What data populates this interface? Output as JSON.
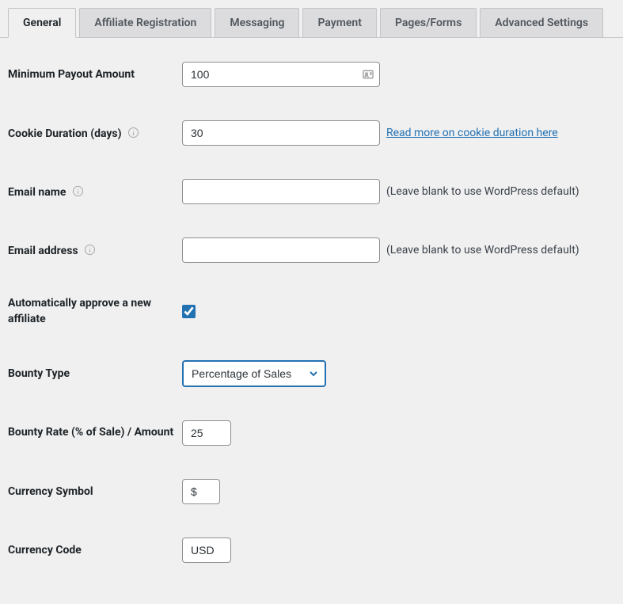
{
  "tabs": {
    "general": "General",
    "affiliate_registration": "Affiliate Registration",
    "messaging": "Messaging",
    "payment": "Payment",
    "pages_forms": "Pages/Forms",
    "advanced_settings": "Advanced Settings"
  },
  "fields": {
    "min_payout": {
      "label": "Minimum Payout Amount",
      "value": "100"
    },
    "cookie_duration": {
      "label": "Cookie Duration (days)",
      "value": "30",
      "link_text": "Read more on cookie duration here"
    },
    "email_name": {
      "label": "Email name",
      "value": "",
      "hint": "(Leave blank to use WordPress default)"
    },
    "email_address": {
      "label": "Email address",
      "value": "",
      "hint": "(Leave blank to use WordPress default)"
    },
    "auto_approve": {
      "label": "Automatically approve a new affiliate"
    },
    "bounty_type": {
      "label": "Bounty Type",
      "value": "Percentage of Sales"
    },
    "bounty_rate": {
      "label": "Bounty Rate (% of Sale) / Amount",
      "value": "25"
    },
    "currency_symbol": {
      "label": "Currency Symbol",
      "value": "$"
    },
    "currency_code": {
      "label": "Currency Code",
      "value": "USD"
    }
  }
}
